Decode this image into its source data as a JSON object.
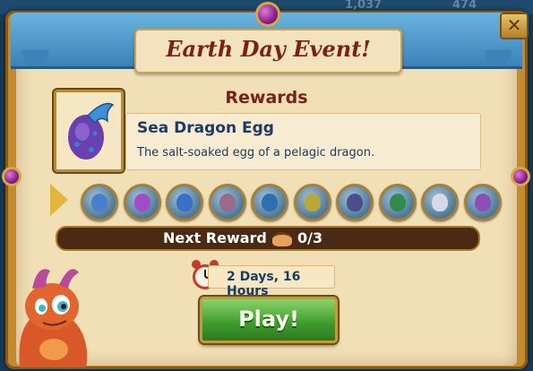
{
  "background": {
    "numbers": [
      "1,037",
      "474"
    ]
  },
  "header": {
    "title": "Earth Day Event!",
    "close_label": "✕"
  },
  "rewards": {
    "heading": "Rewards",
    "featured": {
      "name": "Sea Dragon Egg",
      "description": "The salt-soaked egg of a pelagic dragon.",
      "icon": "dragon-egg-icon"
    },
    "slots": [
      {
        "icon": "sea-egg-icon",
        "color": "#4a7fd0"
      },
      {
        "icon": "purple-crystal-icon",
        "color": "#a14bc4"
      },
      {
        "icon": "blue-egg-icon",
        "color": "#3c6fc9"
      },
      {
        "icon": "flower-nest-icon",
        "color": "#9a6a8c"
      },
      {
        "icon": "blue-egg-icon",
        "color": "#2f6fb0"
      },
      {
        "icon": "tree-icon",
        "color": "#b8a83a"
      },
      {
        "icon": "dark-egg-icon",
        "color": "#4d4f8c"
      },
      {
        "icon": "green-plant-icon",
        "color": "#2f8c4c"
      },
      {
        "icon": "white-dragon-icon",
        "color": "#d8d8e6"
      },
      {
        "icon": "purple-dragon-icon",
        "color": "#8c4fb8"
      }
    ]
  },
  "progress": {
    "label": "Next Reward",
    "count": "0/3",
    "fraction": 0
  },
  "timer": {
    "text": "2 Days, 16 Hours"
  },
  "play_label": "Play!"
}
